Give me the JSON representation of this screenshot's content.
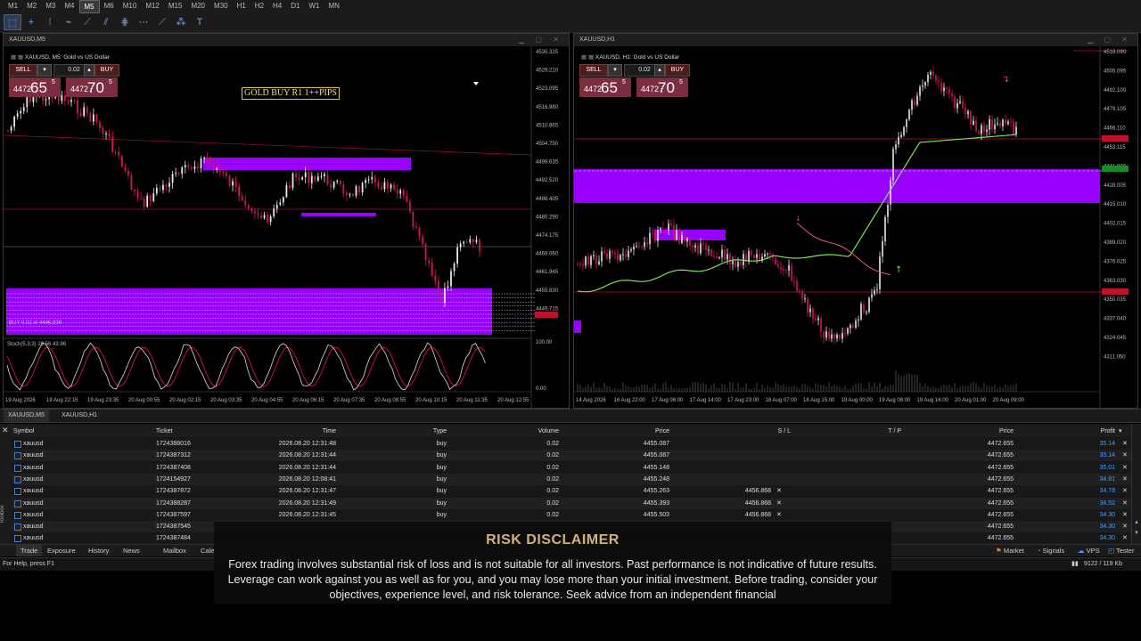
{
  "timeframes": [
    "M1",
    "M2",
    "M3",
    "M4",
    "M5",
    "M6",
    "M10",
    "M12",
    "M15",
    "M20",
    "M30",
    "H1",
    "H2",
    "H4",
    "D1",
    "W1",
    "MN"
  ],
  "active_timeframe": "M5",
  "tools": [
    {
      "name": "cursor-icon",
      "glyph": "⬚"
    },
    {
      "name": "crosshair-icon",
      "glyph": "+"
    },
    {
      "name": "vertical-line-icon",
      "glyph": "⁞"
    },
    {
      "name": "horizontal-line-icon",
      "glyph": "⌁"
    },
    {
      "name": "trendline-icon",
      "glyph": "⟋"
    },
    {
      "name": "channel-icon",
      "glyph": "⫽"
    },
    {
      "name": "fibonacci-icon",
      "glyph": "⋕"
    },
    {
      "name": "gann-icon",
      "glyph": "⋯"
    },
    {
      "name": "pitchfork-icon",
      "glyph": "⟋"
    },
    {
      "name": "shapes-icon",
      "glyph": "⁂"
    },
    {
      "name": "text-icon",
      "glyph": "T"
    }
  ],
  "chart_left": {
    "window_title": "XAUUSD,M5",
    "symbol_desc": "XAUUSD, M5:  Gold vs US Dollar",
    "sell_label": "SELL",
    "buy_label": "BUY",
    "lot": "0.02",
    "bid_small": "4472",
    "bid_big": "65",
    "bid_sup": "5",
    "ask_small": "4472",
    "ask_big": "70",
    "ask_sup": "5",
    "note_text": "GOLD BUY R1 1++PIPS",
    "price_labels": [
      "4535.325",
      "4529.210",
      "4523.095",
      "4516.980",
      "4510.865",
      "4504.750",
      "4498.635",
      "4492.520",
      "4486.405",
      "4480.290",
      "4474.175",
      "4468.060",
      "4461.945",
      "4455.830",
      "4449.715"
    ],
    "stoch_labels": [
      "100.00",
      "0.00"
    ],
    "stoch_title": "Stoch(5,3,3) 29.56 43.96",
    "order_label": "BUY 0.02 at 4446.838",
    "time_labels": [
      "19 Aug 2026",
      "19 Aug 22:15",
      "19 Aug 23:35",
      "20 Aug 00:55",
      "20 Aug 02:15",
      "20 Aug 03:35",
      "20 Aug 04:55",
      "20 Aug 06:15",
      "20 Aug 07:35",
      "20 Aug 08:55",
      "20 Aug 10:15",
      "20 Aug 11:35",
      "20 Aug 12:55"
    ]
  },
  "chart_right": {
    "window_title": "XAUUSD,H1",
    "symbol_desc": "XAUUSD, H1:  Gold vs US Dollar",
    "sell_label": "SELL",
    "buy_label": "BUY",
    "lot": "0.02",
    "bid_small": "4472",
    "bid_big": "65",
    "bid_sup": "5",
    "ask_small": "4472",
    "ask_big": "70",
    "ask_sup": "5",
    "price_labels": [
      "4518.090",
      "4505.095",
      "4492.100",
      "4479.105",
      "4466.110",
      "4453.115",
      "4441.000",
      "4428.005",
      "4415.010",
      "4402.015",
      "4389.020",
      "4376.025",
      "4363.030",
      "4350.035",
      "4337.040",
      "4324.045",
      "4311.050"
    ],
    "time_labels": [
      "14 Aug 2026",
      "16 Aug 22:00",
      "17 Aug 06:00",
      "17 Aug 14:00",
      "17 Aug 23:00",
      "18 Aug 07:00",
      "18 Aug 15:00",
      "19 Aug 00:00",
      "19 Aug 08:00",
      "19 Aug 16:00",
      "20 Aug 01:00",
      "20 Aug 09:00"
    ]
  },
  "chart_tabs": [
    "XAUUSD,M5",
    "XAUUSD,H1"
  ],
  "terminal": {
    "columns": [
      "Symbol",
      "Ticket",
      "Time",
      "Type",
      "Volume",
      "Price",
      "S / L",
      "T / P",
      "Price",
      "Profit"
    ],
    "rows": [
      {
        "symbol": "xauusd",
        "ticket": "1724388016",
        "time": "2026.08.20 12:31:48",
        "type": "buy",
        "volume": "0.02",
        "price": "4455.087",
        "sl": "",
        "tp": "",
        "cur": "4472.655",
        "profit": "35.14"
      },
      {
        "symbol": "xauusd",
        "ticket": "1724387312",
        "time": "2026.08.20 12:31:44",
        "type": "buy",
        "volume": "0.02",
        "price": "4455.087",
        "sl": "",
        "tp": "",
        "cur": "4472.655",
        "profit": "35.14"
      },
      {
        "symbol": "xauusd",
        "ticket": "1724387408",
        "time": "2026.08.20 12:31:44",
        "type": "buy",
        "volume": "0.02",
        "price": "4455.148",
        "sl": "",
        "tp": "",
        "cur": "4472.655",
        "profit": "35.01"
      },
      {
        "symbol": "xauusd",
        "ticket": "1724154927",
        "time": "2026.08.20 12:08:41",
        "type": "buy",
        "volume": "0.02",
        "price": "4455.248",
        "sl": "",
        "tp": "",
        "cur": "4472.655",
        "profit": "34.81"
      },
      {
        "symbol": "xauusd",
        "ticket": "1724387872",
        "time": "2026.08.20 12:31:47",
        "type": "buy",
        "volume": "0.02",
        "price": "4455.263",
        "sl": "4456.868",
        "tp": "",
        "cur": "4472.655",
        "profit": "34.78"
      },
      {
        "symbol": "xauusd",
        "ticket": "1724388287",
        "time": "2026.08.20 12:31:49",
        "type": "buy",
        "volume": "0.02",
        "price": "4455.393",
        "sl": "4456.868",
        "tp": "",
        "cur": "4472.655",
        "profit": "34.52"
      },
      {
        "symbol": "xauusd",
        "ticket": "1724387597",
        "time": "2026.08.20 12:31:45",
        "type": "buy",
        "volume": "0.02",
        "price": "4455.503",
        "sl": "4456.868",
        "tp": "",
        "cur": "4472.655",
        "profit": "34.30"
      },
      {
        "symbol": "xauusd",
        "ticket": "1724387545",
        "time": "",
        "type": "",
        "volume": "",
        "price": "",
        "sl": "",
        "tp": "",
        "cur": "4472.655",
        "profit": "34.30"
      },
      {
        "symbol": "xauusd",
        "ticket": "1724387484",
        "time": "",
        "type": "",
        "volume": "",
        "price": "",
        "sl": "",
        "tp": "",
        "cur": "4472.655",
        "profit": "34.30"
      }
    ]
  },
  "bottom_tabs": [
    "Trade",
    "Exposure",
    "History",
    "News",
    "Mailbox",
    "Cale"
  ],
  "bottom_tabs_right": [
    "Market",
    "Signals",
    "VPS",
    "Tester"
  ],
  "toolbox_label": "Toolbox",
  "status_left": "For Help, press F1",
  "status_right": "9122 / 119 Kb",
  "disclaimer": {
    "title": "RISK DISCLAIMER",
    "text": "Forex trading involves substantial risk of loss and is not suitable for all investors. Past performance is not indicative of future results. Leverage can work against you as well as for you, and you may lose more than your initial investment. Before trading, consider your objectives, experience level, and risk tolerance. Seek advice from an independent financial"
  },
  "colors": {
    "bull": "#e8e8e8",
    "bear": "#d4145a",
    "zone": "#9a00ff",
    "ma_green": "#7ee05a",
    "ma_red": "#e06070",
    "grid": "#1e1e1e",
    "profit": "#4d9bff"
  }
}
